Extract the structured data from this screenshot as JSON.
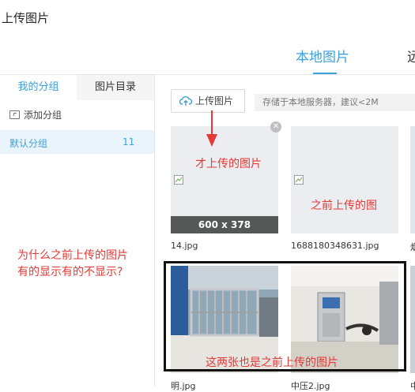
{
  "dialog": {
    "title": "上传图片"
  },
  "top_tabs": [
    {
      "label": "本地图片",
      "active": true
    },
    {
      "label": "远"
    }
  ],
  "sidebar": {
    "tabs": [
      {
        "label": "我的分组",
        "active": true
      },
      {
        "label": "图片目录"
      }
    ],
    "add_group_label": "添加分组",
    "groups": [
      {
        "name": "默认分组",
        "count": "11"
      }
    ]
  },
  "main": {
    "upload_button_label": "上传图片",
    "upload_hint": "存储于本地服务器，建议<2M",
    "images": [
      {
        "filename": "14.jpg",
        "size_label": "600 x 378"
      },
      {
        "filename": "1688180348631.jpg"
      },
      {
        "filename": "烟"
      },
      {
        "filename": "明.jpg"
      },
      {
        "filename": "中压2.jpg"
      },
      {
        "filename": "中"
      }
    ]
  },
  "annotations": {
    "card1": "才上传的图片",
    "card2": "之前上传的图",
    "question_line1": "为什么之前上传的图片",
    "question_line2": "有的显示有的不显示?",
    "bottom": "这两张也是之前上传的图片"
  },
  "colors": {
    "accent": "#3f9fd8",
    "annotation": "#e53935"
  }
}
